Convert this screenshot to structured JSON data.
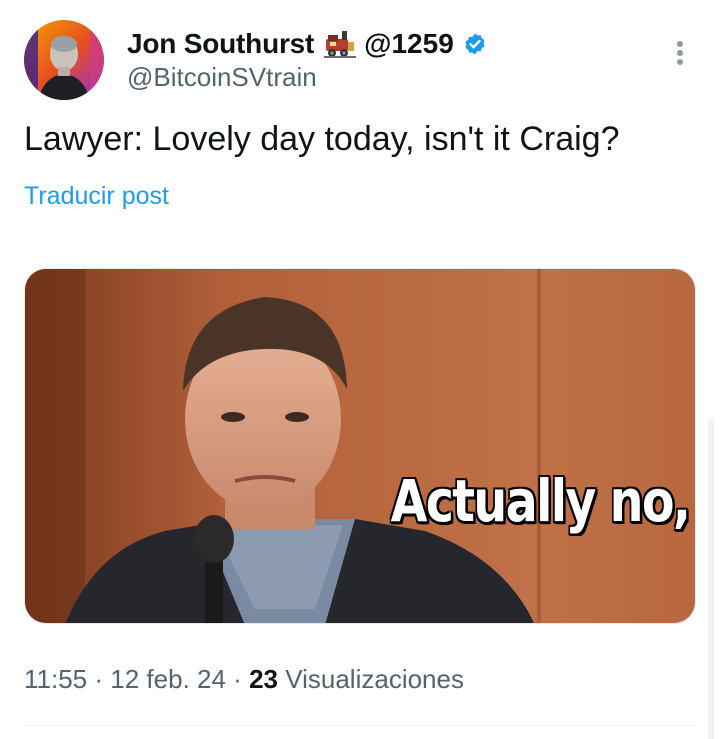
{
  "author": {
    "display_name": "Jon Southurst",
    "emoji_icon": "train-emoji-icon",
    "badge_text": "@1259",
    "verified": true,
    "handle": "@BitcoinSVtrain"
  },
  "tweet": {
    "text": "Lawyer: Lovely day today, isn't it Craig?",
    "translate_label": "Traducir post"
  },
  "media": {
    "caption": "Actually no,"
  },
  "meta": {
    "time": "11:55",
    "separator": "·",
    "date": "12 feb. 24",
    "views_count": "23",
    "views_label": "Visualizaciones"
  },
  "colors": {
    "link": "#1d9bf0",
    "secondary_text": "#536471",
    "verified": "#1d9bf0"
  }
}
